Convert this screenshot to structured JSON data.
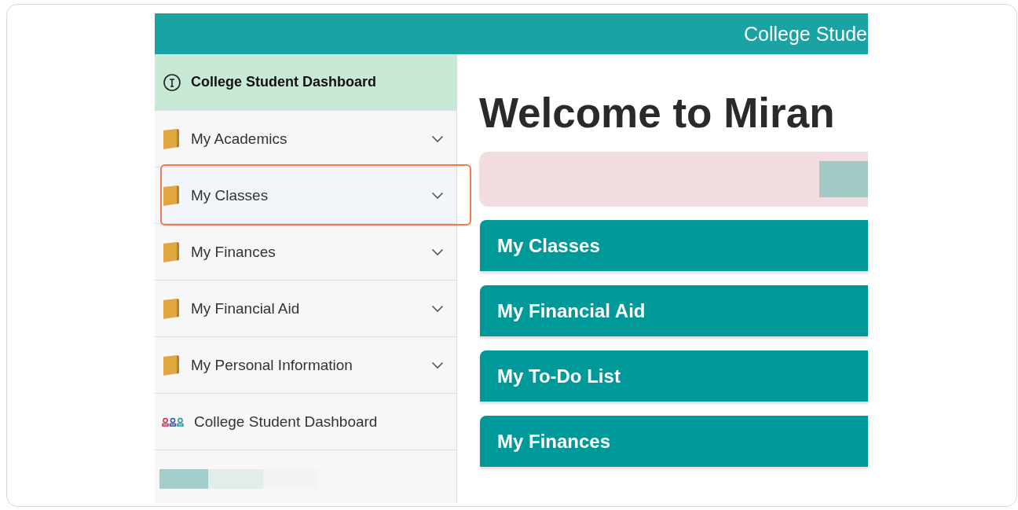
{
  "header": {
    "title": "College Stude"
  },
  "sidebar": {
    "title": "College Student Dashboard",
    "items": [
      {
        "kind": "folder",
        "label": "My Academics",
        "expanded": false,
        "highlighted": false
      },
      {
        "kind": "folder",
        "label": "My Classes",
        "expanded": false,
        "highlighted": true
      },
      {
        "kind": "folder",
        "label": "My Finances",
        "expanded": false,
        "highlighted": false
      },
      {
        "kind": "folder",
        "label": "My Financial Aid",
        "expanded": false,
        "highlighted": false
      },
      {
        "kind": "folder",
        "label": "My Personal Information",
        "expanded": false,
        "highlighted": false
      },
      {
        "kind": "people",
        "label": "College Student Dashboard",
        "highlighted": false
      }
    ]
  },
  "main": {
    "heading": "Welcome to Miran",
    "cards": [
      {
        "title": "My Classes"
      },
      {
        "title": "My Financial Aid"
      },
      {
        "title": "My To-Do List"
      },
      {
        "title": "My Finances"
      }
    ]
  }
}
